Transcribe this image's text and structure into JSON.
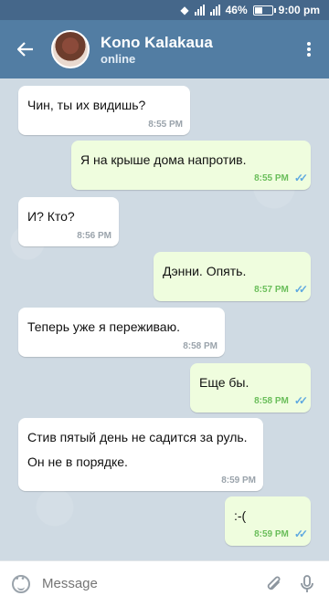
{
  "status_bar": {
    "battery_percent": "46%",
    "battery_level": 0.46,
    "time": "9:00 pm"
  },
  "header": {
    "name": "Kono Kalakaua",
    "status": "online"
  },
  "messages": [
    {
      "dir": "in",
      "text": "Чин, ты их видишь?",
      "time": "8:55 PM"
    },
    {
      "dir": "out",
      "text": "Я на крыше дома напротив.",
      "time": "8:55 PM",
      "read": true
    },
    {
      "dir": "in",
      "text": "И? Кто?",
      "time": "8:56 PM"
    },
    {
      "dir": "out",
      "text": "Дэнни. Опять.",
      "time": "8:57 PM",
      "read": true
    },
    {
      "dir": "in",
      "text": "Теперь уже я переживаю.",
      "time": "8:58 PM"
    },
    {
      "dir": "out",
      "text": "Еще бы.",
      "time": "8:58 PM",
      "read": true
    },
    {
      "dir": "in",
      "text": "Стив пятый день не садится за руль. Он не в порядке.",
      "time": "8:59 PM"
    },
    {
      "dir": "out",
      "text": ":-(",
      "time": "8:59 PM",
      "read": true
    }
  ],
  "input": {
    "placeholder": "Message"
  },
  "icons": {
    "back": "arrow-left-icon",
    "menu": "more-vertical-icon",
    "emoji": "smiley-icon",
    "attach": "paperclip-icon",
    "mic": "microphone-icon"
  },
  "colors": {
    "header": "#527da3",
    "status_bar": "#45678a",
    "incoming": "#ffffff",
    "outgoing": "#effdde",
    "read_check": "#5fa9e0"
  }
}
